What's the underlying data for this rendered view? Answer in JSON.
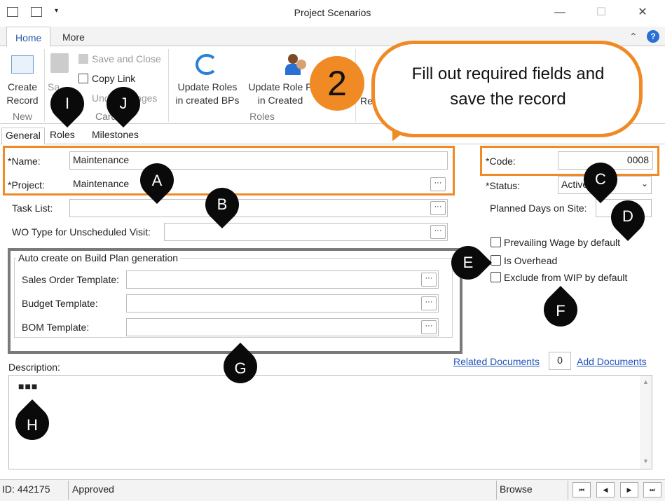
{
  "window": {
    "title": "Project Scenarios",
    "minimize": "—",
    "maximize": "☐",
    "close": "✕"
  },
  "ribbon_tabs": [
    "Home",
    "More"
  ],
  "help_glyph": "?",
  "collapse_glyph": "⌃",
  "ribbon": {
    "create_record": "Create\nRecord",
    "save": "Sa",
    "save_and_close": "Save and Close",
    "copy_link": "Copy Link",
    "undo_changes": "Undo Changes",
    "update_roles_bps": "Update Roles\nin created BPs",
    "update_role_created": "Update Role P\nin Created",
    "res": "Res",
    "group_new": "New",
    "group_card": "Card",
    "group_roles": "Roles"
  },
  "callout": {
    "number": "2",
    "text": "Fill out required fields and save the record"
  },
  "form_tabs": [
    "General",
    "Roles",
    "Milestones"
  ],
  "fields": {
    "name_label": "*Name:",
    "name_value": "Maintenance",
    "project_label": "*Project:",
    "project_value": "Maintenance",
    "tasklist_label": "Task List:",
    "wotype_label": "WO Type for Unscheduled Visit:",
    "code_label": "*Code:",
    "code_value": "0008",
    "status_label": "*Status:",
    "status_value": "Active",
    "planned_label": "Planned Days on Site:",
    "ellipsis": "···"
  },
  "autocreate": {
    "legend": "Auto create on Build Plan generation",
    "sales_order": "Sales Order Template:",
    "budget": "Budget Template:",
    "bom": "BOM Template:"
  },
  "checkboxes": {
    "prevailing_wage": "Prevailing Wage by default",
    "is_overhead": "Is Overhead",
    "exclude_wip": "Exclude from WIP by default"
  },
  "description": {
    "label": "Description:",
    "value": "■■■"
  },
  "documents": {
    "related": "Related Documents",
    "count": "0",
    "add": "Add Documents"
  },
  "markers": [
    "A",
    "B",
    "C",
    "D",
    "E",
    "F",
    "G",
    "H",
    "I",
    "J"
  ],
  "statusbar": {
    "id": "ID: 442175",
    "state": "Approved",
    "mode": "Browse",
    "nav_first": "⏮",
    "nav_prev": "◀",
    "nav_next": "▶",
    "nav_last": "⏭"
  },
  "colors": {
    "accent_orange": "#f08a24",
    "link_blue": "#2255bb",
    "marker_black": "#0a0a0a"
  }
}
